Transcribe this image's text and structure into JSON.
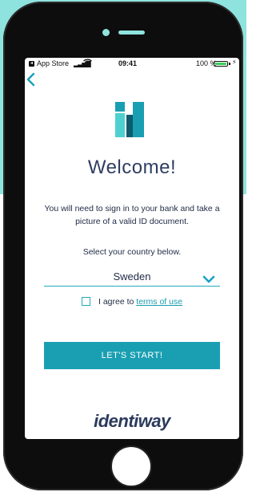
{
  "status_bar": {
    "app_store": "App Store",
    "time": "09:41",
    "battery_pct": "100 %",
    "icons": [
      "signal-icon",
      "wifi-icon",
      "battery-icon",
      "charging-icon"
    ]
  },
  "nav": {
    "back_icon": "chevron-left-icon"
  },
  "main": {
    "title": "Welcome!",
    "description": "You will need to sign in to your bank and take a picture of a valid ID document.",
    "select_label": "Select your country below.",
    "country_selected": "Sweden",
    "agree_prefix": "I agree to ",
    "terms_link": "terms of use",
    "start_button": "LET'S START!",
    "brand": "identiway"
  },
  "colors": {
    "accent": "#1a9fb2",
    "background_teal": "#8fe3de",
    "heading": "#2e3e62",
    "phone": "#0d0d0d"
  }
}
